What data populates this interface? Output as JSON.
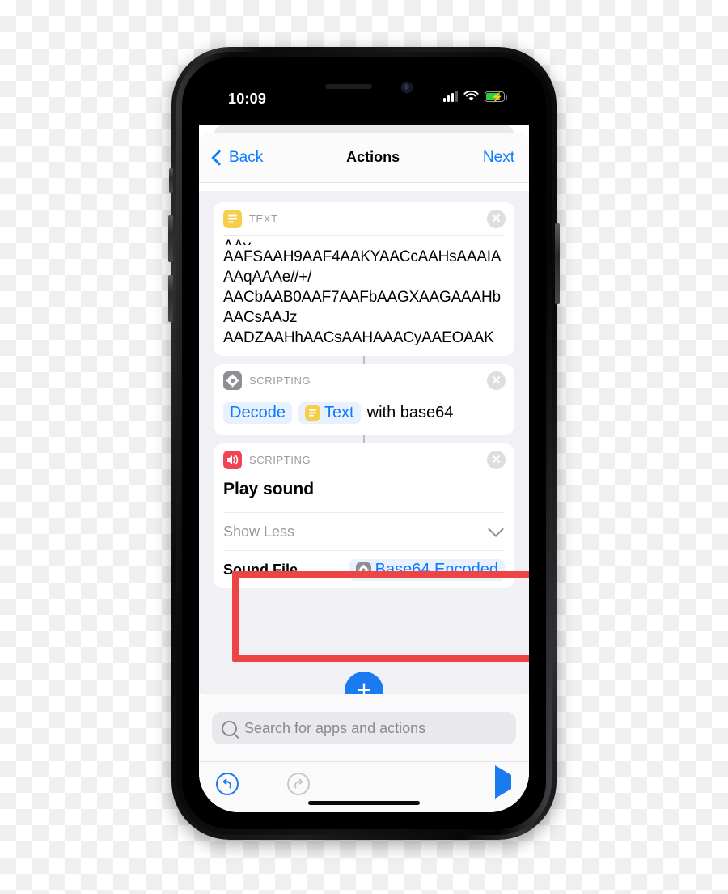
{
  "status_bar": {
    "time": "10:09",
    "signal_icon": "cellular-signal-icon",
    "wifi_icon": "wifi-icon",
    "battery_icon": "battery-charging-icon"
  },
  "navbar": {
    "back_label": "Back",
    "title": "Actions",
    "next_label": "Next"
  },
  "cards": [
    {
      "category": "TEXT",
      "icon": "text-category-icon",
      "icon_color": "#f5ce4e",
      "close_icon": "close-icon",
      "lines": [
        "AAFSAAH9AAF4AAKYAACcAAHsAAAIA",
        "AAqAAAe//+/",
        "AACbAAB0AAF7AAFbAAGXAAGAAAHb",
        "AACsAAJz",
        "AADZAAHhAACsAAHAAACyAAEOAAK"
      ]
    },
    {
      "category": "SCRIPTING",
      "icon": "gear-category-icon",
      "icon_color": "#8e8e93",
      "close_icon": "close-icon",
      "tokens": {
        "decode": "Decode",
        "text": "Text",
        "suffix": "with base64"
      }
    },
    {
      "category": "SCRIPTING",
      "icon": "speaker-category-icon",
      "icon_color": "#f04455",
      "close_icon": "close-icon",
      "title": "Play sound",
      "show_less_label": "Show Less",
      "chevron_icon": "chevron-down-icon",
      "param_label": "Sound File",
      "param_value": "Base64 Encoded",
      "param_value_icon": "gear-mini-icon"
    }
  ],
  "add_button": {
    "label": "+",
    "color": "#1a7af0"
  },
  "search": {
    "placeholder": "Search for apps and actions",
    "icon": "search-icon"
  },
  "toolbar": {
    "undo_icon": "undo-icon",
    "redo_icon": "redo-icon",
    "run_icon": "play-icon"
  },
  "highlight": {
    "color": "#ef4444"
  }
}
